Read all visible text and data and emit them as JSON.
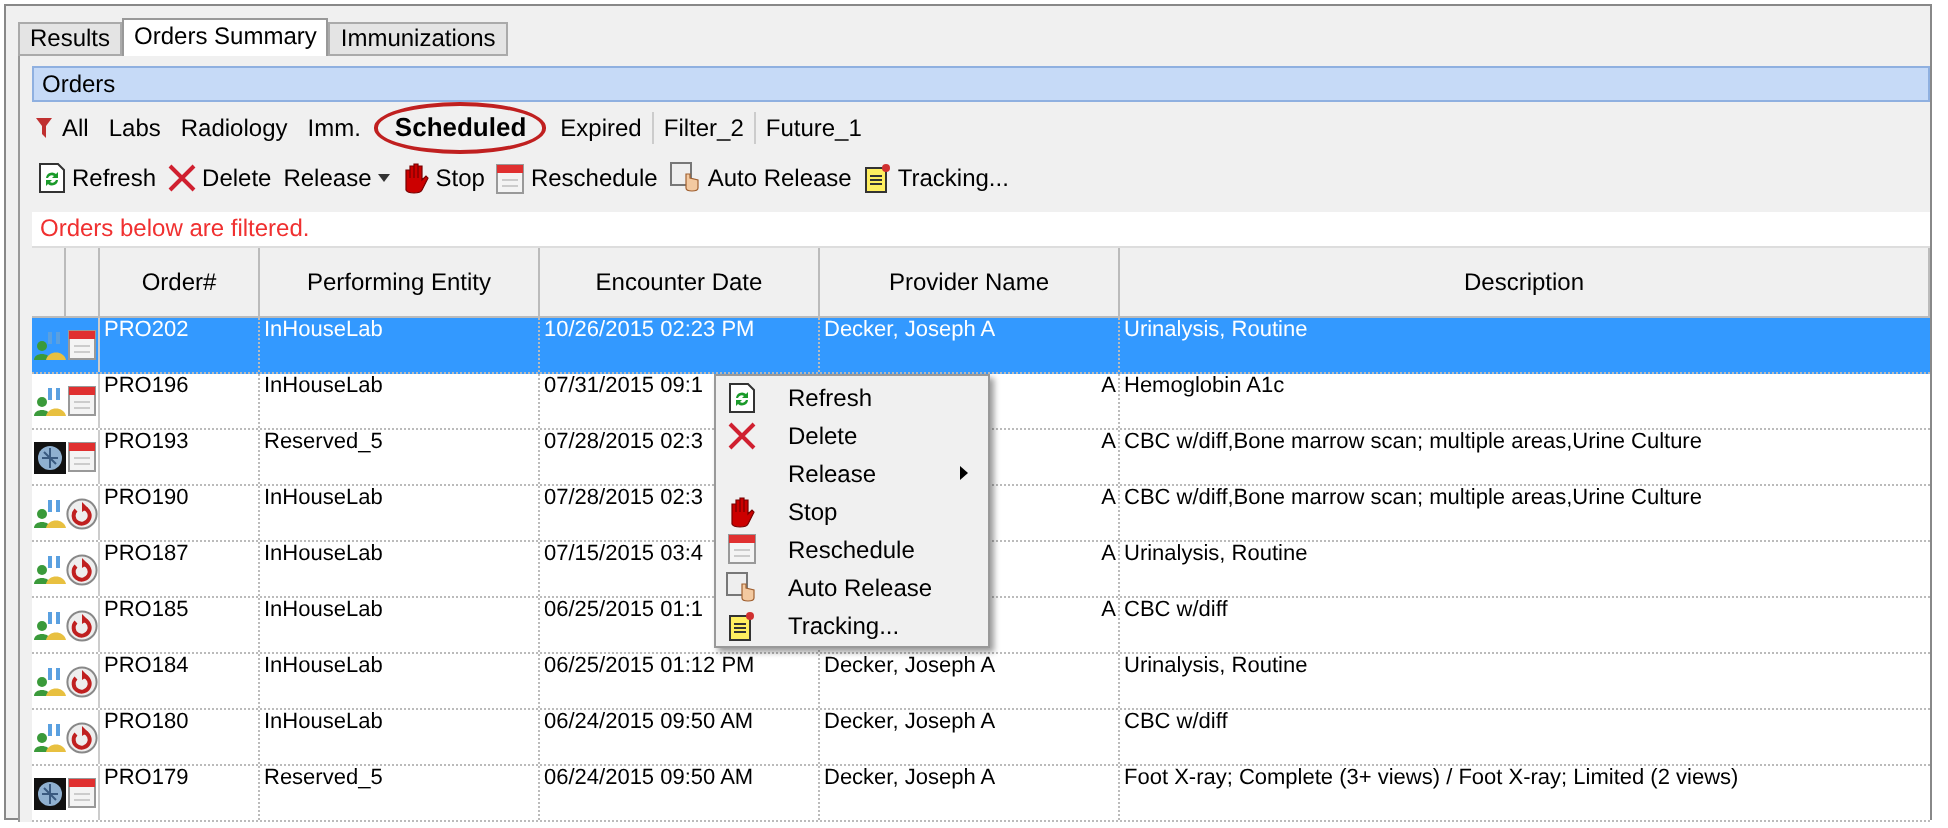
{
  "tabs": [
    {
      "label": "Results",
      "selected": false
    },
    {
      "label": "Orders Summary",
      "selected": true
    },
    {
      "label": "Immunizations",
      "selected": false
    }
  ],
  "panel": {
    "title": "Orders"
  },
  "filters": [
    {
      "label": "All",
      "selected": false,
      "separator": false
    },
    {
      "label": "Labs",
      "selected": false,
      "separator": false
    },
    {
      "label": "Radiology",
      "selected": false,
      "separator": false
    },
    {
      "label": "Imm.",
      "selected": false,
      "separator": false
    },
    {
      "label": "Scheduled",
      "selected": true,
      "separator": false
    },
    {
      "label": "Expired",
      "selected": false,
      "separator": true
    },
    {
      "label": "Filter_2",
      "selected": false,
      "separator": true
    },
    {
      "label": "Future_1",
      "selected": false,
      "separator": false
    }
  ],
  "toolbar": [
    {
      "kind": "refresh",
      "label": "Refresh"
    },
    {
      "kind": "delete",
      "label": "Delete"
    },
    {
      "kind": "release",
      "label": "Release"
    },
    {
      "kind": "stop",
      "label": "Stop"
    },
    {
      "kind": "reschedule",
      "label": "Reschedule"
    },
    {
      "kind": "auto",
      "label": "Auto Release"
    },
    {
      "kind": "tracking",
      "label": "Tracking..."
    }
  ],
  "filter_message": "Orders below are filtered.",
  "table": {
    "columns": [
      "Order#",
      "Performing Entity",
      "Encounter Date",
      "Provider Name",
      "Description"
    ],
    "rows": [
      {
        "icons": [
          {
            "kind": "lab"
          },
          {
            "kind": "calendar"
          }
        ],
        "selected": true,
        "cells": [
          "PRO202",
          "InHouseLab",
          "10/26/2015 02:23 PM",
          "Decker, Joseph A",
          "Urinalysis, Routine"
        ]
      },
      {
        "icons": [
          {
            "kind": "lab"
          },
          {
            "kind": "calendar"
          }
        ],
        "selected": false,
        "cells": [
          "PRO196",
          "InHouseLab",
          "07/31/2015 09:1",
          "A",
          "Hemoglobin A1c"
        ]
      },
      {
        "icons": [
          {
            "kind": "scan"
          },
          {
            "kind": "calendar"
          }
        ],
        "selected": false,
        "cells": [
          "PRO193",
          "Reserved_5",
          "07/28/2015 02:3",
          "A",
          "CBC w/diff,Bone marrow scan; multiple areas,Urine Culture"
        ]
      },
      {
        "icons": [
          {
            "kind": "lab"
          },
          {
            "kind": "recurring"
          }
        ],
        "selected": false,
        "cells": [
          "PRO190",
          "InHouseLab",
          "07/28/2015 02:3",
          "A",
          "CBC w/diff,Bone marrow scan; multiple areas,Urine Culture"
        ]
      },
      {
        "icons": [
          {
            "kind": "lab"
          },
          {
            "kind": "recurring"
          }
        ],
        "selected": false,
        "cells": [
          "PRO187",
          "InHouseLab",
          "07/15/2015 03:4",
          "A",
          "Urinalysis, Routine"
        ]
      },
      {
        "icons": [
          {
            "kind": "lab"
          },
          {
            "kind": "recurring"
          }
        ],
        "selected": false,
        "cells": [
          "PRO185",
          "InHouseLab",
          "06/25/2015 01:1",
          "A",
          "CBC w/diff"
        ]
      },
      {
        "icons": [
          {
            "kind": "lab"
          },
          {
            "kind": "recurring"
          }
        ],
        "selected": false,
        "cells": [
          "PRO184",
          "InHouseLab",
          "06/25/2015 01:12 PM",
          "Decker, Joseph A",
          "Urinalysis, Routine"
        ]
      },
      {
        "icons": [
          {
            "kind": "lab"
          },
          {
            "kind": "recurring"
          }
        ],
        "selected": false,
        "cells": [
          "PRO180",
          "InHouseLab",
          "06/24/2015 09:50 AM",
          "Decker, Joseph A",
          "CBC w/diff"
        ]
      },
      {
        "icons": [
          {
            "kind": "scan"
          },
          {
            "kind": "calendar"
          }
        ],
        "selected": false,
        "cells": [
          "PRO179",
          "Reserved_5",
          "06/24/2015 09:50 AM",
          "Decker, Joseph A",
          "Foot X-ray; Complete (3+ views) / Foot X-ray; Limited (2 views)"
        ]
      }
    ]
  },
  "context_menu": [
    {
      "kind": "refresh",
      "label": "Refresh",
      "submenu": false
    },
    {
      "kind": "delete",
      "label": "Delete",
      "submenu": false
    },
    {
      "kind": "release",
      "label": "Release",
      "submenu": true
    },
    {
      "kind": "stop",
      "label": "Stop",
      "submenu": false
    },
    {
      "kind": "reschedule",
      "label": "Reschedule",
      "submenu": false
    },
    {
      "kind": "auto",
      "label": "Auto Release",
      "submenu": false
    },
    {
      "kind": "tracking",
      "label": "Tracking...",
      "submenu": false
    }
  ]
}
